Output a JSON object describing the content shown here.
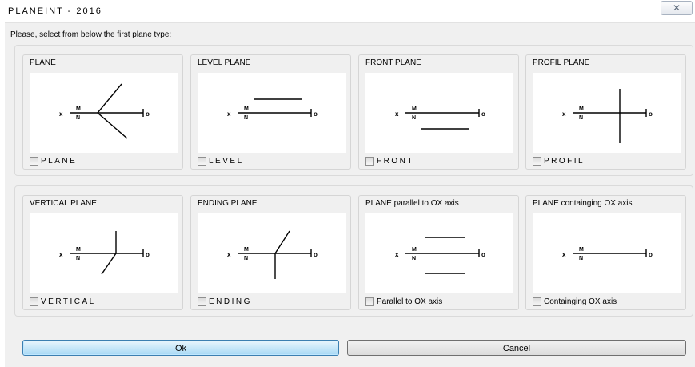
{
  "window": {
    "title": "PLANEINT - 2016",
    "close_glyph": "✕"
  },
  "instruction": "Please, select from below the first plane type:",
  "axis_labels": {
    "x": "x",
    "m": "M",
    "n": "N",
    "o": "o"
  },
  "panels": [
    {
      "title": "PLANE",
      "checkbox_label": "PLANE",
      "checked": false,
      "diagram": "plane"
    },
    {
      "title": "LEVEL PLANE",
      "checkbox_label": "LEVEL",
      "checked": false,
      "diagram": "level"
    },
    {
      "title": "FRONT PLANE",
      "checkbox_label": "FRONT",
      "checked": false,
      "diagram": "front"
    },
    {
      "title": "PROFIL PLANE",
      "checkbox_label": "PROFIL",
      "checked": false,
      "diagram": "profil"
    },
    {
      "title": "VERTICAL PLANE",
      "checkbox_label": "VERTICAL",
      "checked": false,
      "diagram": "vertical"
    },
    {
      "title": "ENDING PLANE",
      "checkbox_label": "ENDING",
      "checked": false,
      "diagram": "ending"
    },
    {
      "title": "PLANE parallel to OX axis",
      "checkbox_label": "Parallel to OX axis",
      "checked": false,
      "diagram": "parallel-ox"
    },
    {
      "title": "PLANE containging OX axis",
      "checkbox_label": "Containging OX axis",
      "checked": false,
      "diagram": "containing-ox"
    }
  ],
  "buttons": {
    "ok": "Ok",
    "cancel": "Cancel"
  },
  "colors": {
    "dialog_bg": "#f0f0f0",
    "canvas_bg": "#ffffff",
    "ok_border": "#3c7fb1",
    "ok_fill": "#a7d9f5"
  }
}
